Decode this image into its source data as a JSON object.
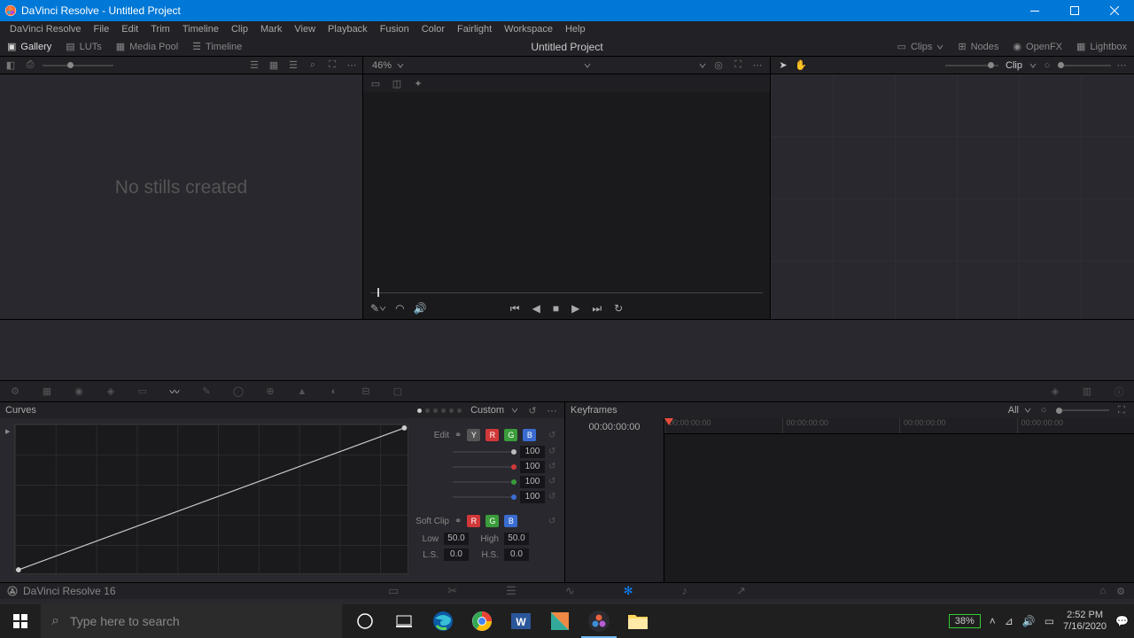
{
  "titlebar": {
    "title": "DaVinci Resolve - Untitled Project"
  },
  "menubar": [
    "DaVinci Resolve",
    "File",
    "Edit",
    "Trim",
    "Timeline",
    "Clip",
    "Mark",
    "View",
    "Playback",
    "Fusion",
    "Color",
    "Fairlight",
    "Workspace",
    "Help"
  ],
  "workspace": {
    "left": [
      "Gallery",
      "LUTs",
      "Media Pool",
      "Timeline"
    ],
    "title": "Untitled Project",
    "right": [
      "Clips",
      "Nodes",
      "OpenFX",
      "Lightbox"
    ]
  },
  "gallery": {
    "placeholder": "No stills created"
  },
  "viewer": {
    "zoom": "46%"
  },
  "nodes": {
    "mode": "Clip"
  },
  "curves": {
    "title": "Curves",
    "mode": "Custom",
    "edit_label": "Edit",
    "channels": [
      "Y",
      "R",
      "G",
      "B"
    ],
    "sliders": [
      {
        "color": "#bbb",
        "value": "100"
      },
      {
        "color": "#d03838",
        "value": "100"
      },
      {
        "color": "#3a9c3a",
        "value": "100"
      },
      {
        "color": "#3a6cd0",
        "value": "100"
      }
    ],
    "softclip_label": "Soft Clip",
    "low_label": "Low",
    "low": "50.0",
    "high_label": "High",
    "high": "50.0",
    "ls_label": "L.S.",
    "ls": "0.0",
    "hs_label": "H.S.",
    "hs": "0.0"
  },
  "keyframes": {
    "title": "Keyframes",
    "mode": "All",
    "timecode": "00:00:00:00",
    "ticks": [
      "00:00:00:00",
      "00:00:00:00",
      "00:00:00:00",
      "00:00:00:00"
    ]
  },
  "footer": {
    "app": "DaVinci Resolve 16"
  },
  "taskbar": {
    "search_placeholder": "Type here to search",
    "battery": "38%",
    "time": "2:52 PM",
    "date": "7/16/2020"
  }
}
